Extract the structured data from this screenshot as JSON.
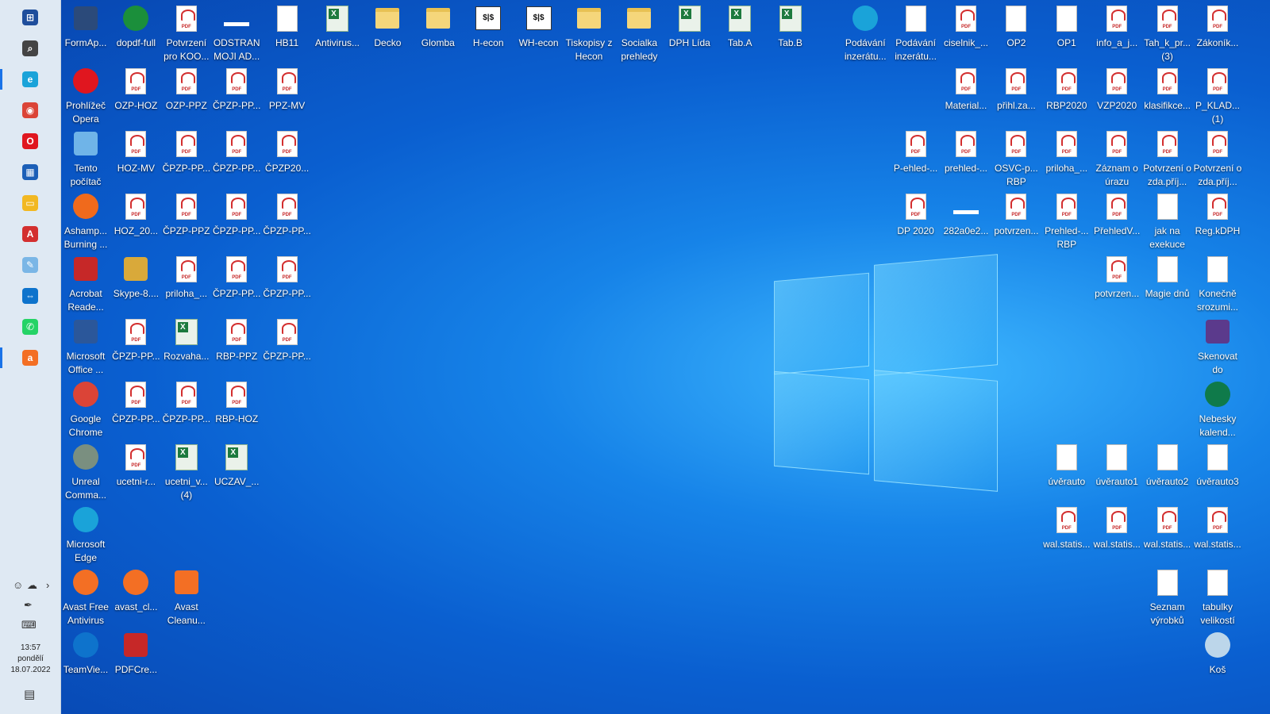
{
  "taskbar": {
    "apps": [
      {
        "name": "start-button",
        "icon": "windows-icon",
        "color": "#1f4e9c",
        "glyph": "⊞"
      },
      {
        "name": "search-button",
        "icon": "search-icon",
        "color": "#444444",
        "glyph": "⌕"
      },
      {
        "name": "taskbar-edge",
        "icon": "edge-icon",
        "color": "#1aa3d9",
        "glyph": "e"
      },
      {
        "name": "taskbar-chrome",
        "icon": "chrome-icon",
        "color": "#db4437",
        "glyph": "◉"
      },
      {
        "name": "taskbar-opera",
        "icon": "opera-icon",
        "color": "#e0161f",
        "glyph": "O"
      },
      {
        "name": "taskbar-store",
        "icon": "store-icon",
        "color": "#1c5fb7",
        "glyph": "▦"
      },
      {
        "name": "taskbar-explorer",
        "icon": "folder-icon",
        "color": "#f2b822",
        "glyph": "▭"
      },
      {
        "name": "taskbar-acrobat",
        "icon": "acrobat-icon",
        "color": "#d32f2f",
        "glyph": "A"
      },
      {
        "name": "taskbar-paint",
        "icon": "paint-icon",
        "color": "#7ab6e6",
        "glyph": "✎"
      },
      {
        "name": "taskbar-teamviewer",
        "icon": "teamviewer-icon",
        "color": "#0e73cc",
        "glyph": "⇔"
      },
      {
        "name": "taskbar-whatsapp",
        "icon": "whatsapp-icon",
        "color": "#25d366",
        "glyph": "✆"
      },
      {
        "name": "taskbar-avast",
        "icon": "avast-icon",
        "color": "#f36f24",
        "glyph": "a"
      }
    ],
    "clock": {
      "time": "13:57",
      "day": "pondělí",
      "date": "18.07.2022"
    }
  },
  "desktop": {
    "icons": [
      {
        "col": 0,
        "row": 0,
        "label": "FormAp...",
        "type": "app",
        "color": "#2b4a7a",
        "icon": "formapp-icon"
      },
      {
        "col": 0,
        "row": 1,
        "label": "Prohlížeč Opera",
        "type": "round",
        "color": "#e0161f",
        "icon": "opera-icon"
      },
      {
        "col": 0,
        "row": 2,
        "label": "Tento počítač",
        "type": "sq",
        "color": "#6fb4e8",
        "icon": "computer-icon"
      },
      {
        "col": 0,
        "row": 3,
        "label": "Ashamp... Burning ...",
        "type": "round",
        "color": "#f06a1c",
        "icon": "ashampoo-icon"
      },
      {
        "col": 0,
        "row": 4,
        "label": "Acrobat Reade...",
        "type": "sq",
        "color": "#c62828",
        "icon": "acrobat-icon"
      },
      {
        "col": 0,
        "row": 5,
        "label": "Microsoft Office ...",
        "type": "sq",
        "color": "#2b579a",
        "icon": "word-icon"
      },
      {
        "col": 0,
        "row": 6,
        "label": "Google Chrome",
        "type": "round",
        "color": "#db4437",
        "icon": "chrome-icon"
      },
      {
        "col": 0,
        "row": 7,
        "label": "Unreal Comma...",
        "type": "round",
        "color": "#7a8f80",
        "icon": "unreal-commander-icon"
      },
      {
        "col": 0,
        "row": 8,
        "label": "Microsoft Edge",
        "type": "round",
        "color": "#1aa3d9",
        "icon": "edge-icon"
      },
      {
        "col": 0,
        "row": 9,
        "label": "Avast Free Antivirus",
        "type": "round",
        "color": "#f36f24",
        "icon": "avast-icon"
      },
      {
        "col": 0,
        "row": 10,
        "label": "TeamVie...",
        "type": "round",
        "color": "#0e73cc",
        "icon": "teamviewer-icon"
      },
      {
        "col": 1,
        "row": 0,
        "label": "dopdf-full",
        "type": "round",
        "color": "#1b8f3b",
        "icon": "dopdf-icon"
      },
      {
        "col": 1,
        "row": 1,
        "label": "OZP-HOZ",
        "type": "pdf",
        "icon": "pdf-icon"
      },
      {
        "col": 1,
        "row": 2,
        "label": "HOZ-MV",
        "type": "pdf",
        "icon": "pdf-icon"
      },
      {
        "col": 1,
        "row": 3,
        "label": "HOZ_20...",
        "type": "pdf",
        "icon": "pdf-icon"
      },
      {
        "col": 1,
        "row": 4,
        "label": "Skype-8....",
        "type": "sq",
        "color": "#d9a93a",
        "icon": "installer-icon"
      },
      {
        "col": 1,
        "row": 5,
        "label": "ČPZP-PP...",
        "type": "pdf",
        "icon": "pdf-icon"
      },
      {
        "col": 1,
        "row": 6,
        "label": "ČPZP-PP...",
        "type": "pdf",
        "icon": "pdf-icon"
      },
      {
        "col": 1,
        "row": 7,
        "label": "ucetni-r...",
        "type": "pdf",
        "icon": "pdf-icon"
      },
      {
        "col": 1,
        "row": 9,
        "label": "avast_cl...",
        "type": "round",
        "color": "#f36f24",
        "icon": "avast-cleanup-icon"
      },
      {
        "col": 1,
        "row": 10,
        "label": "PDFCre...",
        "type": "sq",
        "color": "#c62828",
        "icon": "pdfcreator-icon"
      },
      {
        "col": 2,
        "row": 0,
        "label": "Potvrzení pro KOO...",
        "type": "pdf",
        "icon": "pdf-icon"
      },
      {
        "col": 2,
        "row": 1,
        "label": "OZP-PPZ",
        "type": "pdf",
        "icon": "pdf-icon"
      },
      {
        "col": 2,
        "row": 2,
        "label": "ČPZP-PP...",
        "type": "pdf",
        "icon": "pdf-icon"
      },
      {
        "col": 2,
        "row": 3,
        "label": "ČPZP-PPZ",
        "type": "pdf",
        "icon": "pdf-icon"
      },
      {
        "col": 2,
        "row": 4,
        "label": "priloha_...",
        "type": "pdf",
        "icon": "pdf-icon"
      },
      {
        "col": 2,
        "row": 5,
        "label": "Rozvaha...",
        "type": "xls",
        "icon": "spreadsheet-icon"
      },
      {
        "col": 2,
        "row": 6,
        "label": "ČPZP-PP...",
        "type": "pdf",
        "icon": "pdf-icon"
      },
      {
        "col": 2,
        "row": 7,
        "label": "ucetni_v... (4)",
        "type": "xls",
        "icon": "spreadsheet-icon"
      },
      {
        "col": 2,
        "row": 9,
        "label": "Avast Cleanu...",
        "type": "sq",
        "color": "#f36f24",
        "icon": "avast-cleanup-icon"
      },
      {
        "col": 3,
        "row": 0,
        "label": "ODSTRAN MOJI AD...",
        "type": "thin",
        "icon": "file-icon"
      },
      {
        "col": 3,
        "row": 1,
        "label": "ČPZP-PP...",
        "type": "pdf",
        "icon": "pdf-icon"
      },
      {
        "col": 3,
        "row": 2,
        "label": "ČPZP-PP...",
        "type": "pdf",
        "icon": "pdf-icon"
      },
      {
        "col": 3,
        "row": 3,
        "label": "ČPZP-PP...",
        "type": "pdf",
        "icon": "pdf-icon"
      },
      {
        "col": 3,
        "row": 4,
        "label": "ČPZP-PP...",
        "type": "pdf",
        "icon": "pdf-icon"
      },
      {
        "col": 3,
        "row": 5,
        "label": "RBP-PPZ",
        "type": "pdf",
        "icon": "pdf-icon"
      },
      {
        "col": 3,
        "row": 6,
        "label": "RBP-HOZ",
        "type": "pdf",
        "icon": "pdf-icon"
      },
      {
        "col": 3,
        "row": 7,
        "label": "UCZAV_...",
        "type": "xls",
        "icon": "spreadsheet-icon"
      },
      {
        "col": 4,
        "row": 0,
        "label": "HB11",
        "type": "doc",
        "icon": "document-icon"
      },
      {
        "col": 4,
        "row": 1,
        "label": "PPZ-MV",
        "type": "pdf",
        "icon": "pdf-icon"
      },
      {
        "col": 4,
        "row": 2,
        "label": "ČPZP20...",
        "type": "pdf",
        "icon": "pdf-icon"
      },
      {
        "col": 4,
        "row": 3,
        "label": "ČPZP-PP...",
        "type": "pdf",
        "icon": "pdf-icon"
      },
      {
        "col": 4,
        "row": 4,
        "label": "ČPZP-PP...",
        "type": "pdf",
        "icon": "pdf-icon"
      },
      {
        "col": 4,
        "row": 5,
        "label": "ČPZP-PP...",
        "type": "pdf",
        "icon": "pdf-icon"
      },
      {
        "col": 5,
        "row": 0,
        "label": "Antivirus...",
        "type": "xls",
        "icon": "spreadsheet-icon"
      },
      {
        "col": 6,
        "row": 0,
        "label": "Decko",
        "type": "folder",
        "icon": "folder-icon"
      },
      {
        "col": 7,
        "row": 0,
        "label": "Glomba",
        "type": "folder",
        "icon": "folder-icon"
      },
      {
        "col": 8,
        "row": 0,
        "label": "H-econ",
        "type": "bank",
        "icon": "h-econ-icon"
      },
      {
        "col": 9,
        "row": 0,
        "label": "WH-econ",
        "type": "bank",
        "icon": "wh-econ-icon"
      },
      {
        "col": 10,
        "row": 0,
        "label": "Tiskopisy z Hecon",
        "type": "folder",
        "icon": "folder-icon"
      },
      {
        "col": 11,
        "row": 0,
        "label": "Socialka prehledy",
        "type": "folder",
        "icon": "folder-icon"
      },
      {
        "col": 12,
        "row": 0,
        "label": "DPH Lída",
        "type": "xls",
        "icon": "spreadsheet-icon"
      },
      {
        "col": 13,
        "row": 0,
        "label": "Tab.A",
        "type": "xls",
        "icon": "spreadsheet-icon"
      },
      {
        "col": 14,
        "row": 0,
        "label": "Tab.B",
        "type": "xls",
        "icon": "spreadsheet-icon"
      },
      {
        "rcol": 7,
        "row": 0,
        "label": "Podávání inzerátu...",
        "type": "round",
        "color": "#1aa3d9",
        "icon": "edge-icon"
      },
      {
        "rcol": 6,
        "row": 0,
        "label": "Podávání inzerátu...",
        "type": "doc",
        "icon": "document-icon"
      },
      {
        "rcol": 5,
        "row": 0,
        "label": "ciselnik_...",
        "type": "pdf",
        "icon": "pdf-icon"
      },
      {
        "rcol": 4,
        "row": 0,
        "label": "OP2",
        "type": "doc",
        "icon": "image-icon"
      },
      {
        "rcol": 3,
        "row": 0,
        "label": "OP1",
        "type": "doc",
        "icon": "image-icon"
      },
      {
        "rcol": 2,
        "row": 0,
        "label": "info_a_j...",
        "type": "pdf",
        "icon": "pdf-icon"
      },
      {
        "rcol": 1,
        "row": 0,
        "label": "Tah_k_pr... (3)",
        "type": "pdf",
        "icon": "pdf-icon"
      },
      {
        "rcol": 0,
        "row": 0,
        "label": "Zákoník...",
        "type": "pdf",
        "icon": "pdf-icon"
      },
      {
        "rcol": 5,
        "row": 1,
        "label": "Material...",
        "type": "pdf",
        "icon": "pdf-icon"
      },
      {
        "rcol": 4,
        "row": 1,
        "label": "přihl.za...",
        "type": "pdf",
        "icon": "pdf-icon"
      },
      {
        "rcol": 3,
        "row": 1,
        "label": "RBP2020",
        "type": "pdf",
        "icon": "pdf-icon"
      },
      {
        "rcol": 2,
        "row": 1,
        "label": "VZP2020",
        "type": "pdf",
        "icon": "pdf-icon"
      },
      {
        "rcol": 1,
        "row": 1,
        "label": "klasifikce...",
        "type": "pdf",
        "icon": "pdf-icon"
      },
      {
        "rcol": 0,
        "row": 1,
        "label": "P_KLAD... (1)",
        "type": "pdf",
        "icon": "pdf-icon"
      },
      {
        "rcol": 6,
        "row": 2,
        "label": "P-ehled-...",
        "type": "pdf",
        "icon": "pdf-icon"
      },
      {
        "rcol": 5,
        "row": 2,
        "label": "prehled-...",
        "type": "pdf",
        "icon": "pdf-icon"
      },
      {
        "rcol": 4,
        "row": 2,
        "label": "OSVC-p... RBP",
        "type": "pdf",
        "icon": "pdf-icon"
      },
      {
        "rcol": 3,
        "row": 2,
        "label": "priloha_...",
        "type": "pdf",
        "icon": "pdf-icon"
      },
      {
        "rcol": 2,
        "row": 2,
        "label": "Záznam o úrazu",
        "type": "pdf",
        "icon": "pdf-icon"
      },
      {
        "rcol": 1,
        "row": 2,
        "label": "Potvrzení o zda.příj...",
        "type": "pdf",
        "icon": "pdf-icon"
      },
      {
        "rcol": 0,
        "row": 2,
        "label": "Potvrzení o zda.příj...",
        "type": "pdf",
        "icon": "pdf-icon"
      },
      {
        "rcol": 6,
        "row": 3,
        "label": "DP 2020",
        "type": "pdf",
        "icon": "pdf-icon"
      },
      {
        "rcol": 5,
        "row": 3,
        "label": "282a0e2...",
        "type": "thin",
        "icon": "image-icon"
      },
      {
        "rcol": 4,
        "row": 3,
        "label": "potvrzen...",
        "type": "pdf",
        "icon": "pdf-icon"
      },
      {
        "rcol": 3,
        "row": 3,
        "label": "Prehled-... RBP",
        "type": "pdf",
        "icon": "pdf-icon"
      },
      {
        "rcol": 2,
        "row": 3,
        "label": "PřehledV...",
        "type": "pdf",
        "icon": "pdf-icon"
      },
      {
        "rcol": 1,
        "row": 3,
        "label": "jak na exekuce",
        "type": "doc",
        "icon": "note-icon"
      },
      {
        "rcol": 0,
        "row": 3,
        "label": "Reg.kDPH",
        "type": "pdf",
        "icon": "pdf-icon"
      },
      {
        "rcol": 2,
        "row": 4,
        "label": "potvrzen...",
        "type": "pdf",
        "icon": "pdf-icon"
      },
      {
        "rcol": 1,
        "row": 4,
        "label": "Magie dnů",
        "type": "doc",
        "icon": "document-icon"
      },
      {
        "rcol": 0,
        "row": 4,
        "label": "Konečně srozumi...",
        "type": "doc",
        "icon": "document-icon"
      },
      {
        "rcol": 0,
        "row": 5,
        "label": "Skenovat do",
        "type": "sq",
        "color": "#5b3a8c",
        "icon": "scanner-icon"
      },
      {
        "rcol": 0,
        "row": 6,
        "label": "Nebesky kalend...",
        "type": "round",
        "color": "#0f7a4a",
        "icon": "calendar-icon"
      },
      {
        "rcol": 3,
        "row": 7,
        "label": "úvěrauto",
        "type": "doc",
        "icon": "document-icon"
      },
      {
        "rcol": 2,
        "row": 7,
        "label": "úvěrauto1",
        "type": "doc",
        "icon": "document-icon"
      },
      {
        "rcol": 1,
        "row": 7,
        "label": "úvěrauto2",
        "type": "doc",
        "icon": "document-icon"
      },
      {
        "rcol": 0,
        "row": 7,
        "label": "úvěrauto3",
        "type": "doc",
        "icon": "document-icon"
      },
      {
        "rcol": 3,
        "row": 8,
        "label": "wal.statis...",
        "type": "pdf",
        "icon": "pdf-icon"
      },
      {
        "rcol": 2,
        "row": 8,
        "label": "wal.statis...",
        "type": "pdf",
        "icon": "pdf-icon"
      },
      {
        "rcol": 1,
        "row": 8,
        "label": "wal.statis...",
        "type": "pdf",
        "icon": "pdf-icon"
      },
      {
        "rcol": 0,
        "row": 8,
        "label": "wal.statis...",
        "type": "pdf",
        "icon": "pdf-icon"
      },
      {
        "rcol": 1,
        "row": 9,
        "label": "Seznam výrobků",
        "type": "doc",
        "icon": "document-icon"
      },
      {
        "rcol": 0,
        "row": 9,
        "label": "tabulky velikostí",
        "type": "doc",
        "icon": "document-icon"
      },
      {
        "rcol": 0,
        "row": 10,
        "label": "Koš",
        "type": "round",
        "color": "#bcd6ea",
        "icon": "recycle-bin-icon"
      }
    ]
  }
}
